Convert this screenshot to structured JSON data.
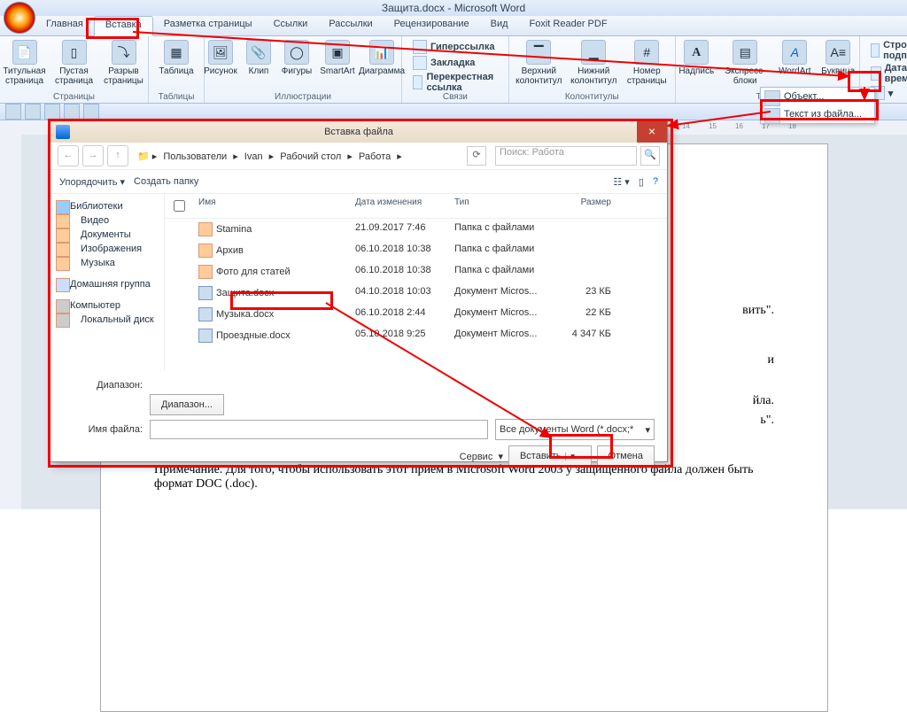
{
  "title": "Защита.docx - Microsoft Word",
  "tabs": [
    "Главная",
    "Вставка",
    "Разметка страницы",
    "Ссылки",
    "Рассылки",
    "Рецензирование",
    "Вид",
    "Foxit Reader PDF"
  ],
  "active_tab": 1,
  "groups": {
    "pages": {
      "label": "Страницы",
      "items": [
        "Титульная страница",
        "Пустая страница",
        "Разрыв страницы"
      ]
    },
    "tables": {
      "label": "Таблицы",
      "item": "Таблица"
    },
    "illus": {
      "label": "Иллюстрации",
      "items": [
        "Рисунок",
        "Клип",
        "Фигуры",
        "SmartArt",
        "Диаграмма"
      ]
    },
    "links": {
      "label": "Связи",
      "items": [
        "Гиперссылка",
        "Закладка",
        "Перекрестная ссылка"
      ]
    },
    "hf": {
      "label": "Колонтитулы",
      "items": [
        "Верхний колонтитул",
        "Нижний колонтитул",
        "Номер страницы"
      ]
    },
    "text": {
      "label": "Текст",
      "items": [
        "Надпись",
        "Экспресс-блоки",
        "WordArt",
        "Буквица"
      ]
    },
    "sym": {
      "items": [
        "Строка подписи",
        "Дата и время"
      ]
    }
  },
  "dropdown": {
    "obj": "Объект...",
    "txt": "Текст из файла..."
  },
  "ruler_marks": [
    "14",
    "15",
    "16",
    "17",
    "18"
  ],
  "doc_lines": [
    "вить\".",
    "и",
    "йла.",
    "ь\"."
  ],
  "doc_note": "Примечание. Для того, чтобы использовать этот приём в Microsoft Word 2003 у защищенного файла должен быть формат DOC (.doc).",
  "dlg": {
    "title": "Вставка файла",
    "crumb": [
      "Пользователи",
      "Ivan",
      "Рабочий стол",
      "Работа"
    ],
    "search_ph": "Поиск: Работа",
    "organize": "Упорядочить",
    "newfolder": "Создать папку",
    "cols": {
      "name": "Имя",
      "date": "Дата изменения",
      "type": "Тип",
      "size": "Размер"
    },
    "tree": {
      "lib": "Библиотеки",
      "video": "Видео",
      "docs": "Документы",
      "img": "Изображения",
      "music": "Музыка",
      "home": "Домашняя группа",
      "comp": "Компьютер",
      "disk": "Локальный диск"
    },
    "rows": [
      {
        "n": "Stamina",
        "d": "21.09.2017 7:46",
        "t": "Папка с файлами",
        "s": "",
        "f": "fld"
      },
      {
        "n": "Архив",
        "d": "06.10.2018 10:38",
        "t": "Папка с файлами",
        "s": "",
        "f": "fld"
      },
      {
        "n": "Фото для статей",
        "d": "06.10.2018 10:38",
        "t": "Папка с файлами",
        "s": "",
        "f": "fld"
      },
      {
        "n": "Защита.docx",
        "d": "04.10.2018 10:03",
        "t": "Документ Micros...",
        "s": "23 КБ",
        "f": "doc"
      },
      {
        "n": "Музыка.docx",
        "d": "06.10.2018 2:44",
        "t": "Документ Micros...",
        "s": "22 КБ",
        "f": "doc"
      },
      {
        "n": "Проездные.docx",
        "d": "05.10.2018 9:25",
        "t": "Документ Micros...",
        "s": "4 347 КБ",
        "f": "doc"
      }
    ],
    "range": "Диапазон:",
    "range_btn": "Диапазон...",
    "fname": "Имя файла:",
    "filter": "Все документы Word (*.docx;*",
    "service": "Сервис",
    "insert": "Вставить",
    "cancel": "Отмена"
  }
}
